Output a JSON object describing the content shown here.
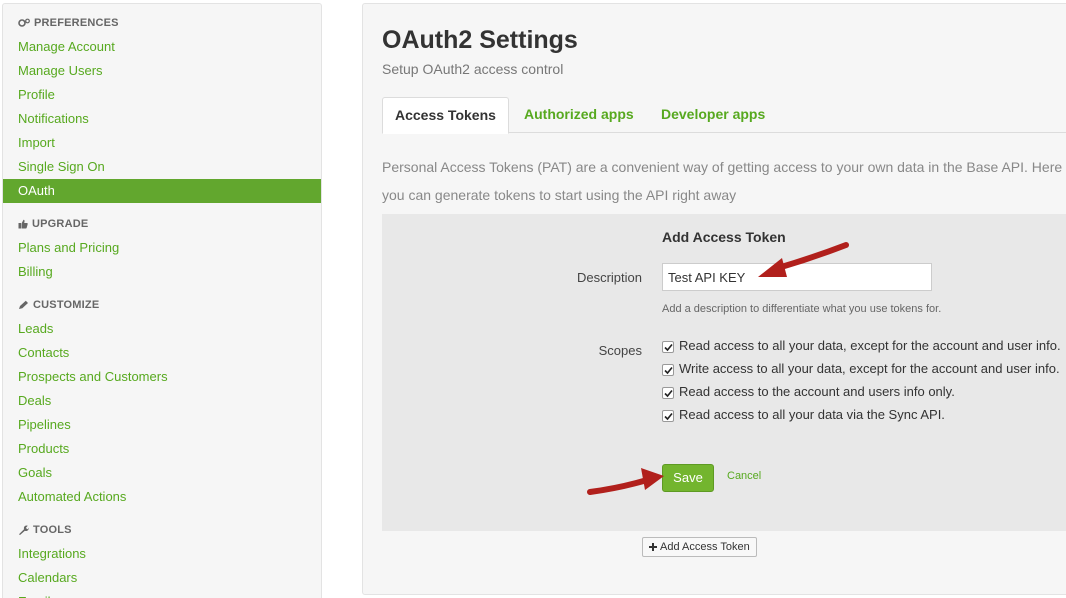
{
  "sidebar": {
    "sections": [
      {
        "title": "PREFERENCES",
        "icon": "gears-icon",
        "items": [
          "Manage Account",
          "Manage Users",
          "Profile",
          "Notifications",
          "Import",
          "Single Sign On",
          "OAuth"
        ]
      },
      {
        "title": "UPGRADE",
        "icon": "thumbs-up-icon",
        "items": [
          "Plans and Pricing",
          "Billing"
        ]
      },
      {
        "title": "CUSTOMIZE",
        "icon": "pencil-icon",
        "items": [
          "Leads",
          "Contacts",
          "Prospects and Customers",
          "Deals",
          "Pipelines",
          "Products",
          "Goals",
          "Automated Actions"
        ]
      },
      {
        "title": "TOOLS",
        "icon": "wrench-icon",
        "items": [
          "Integrations",
          "Calendars",
          "Emails"
        ]
      }
    ],
    "active_item": "OAuth"
  },
  "main": {
    "title": "OAuth2 Settings",
    "subtitle": "Setup OAuth2 access control",
    "tabs": [
      "Access Tokens",
      "Authorized apps",
      "Developer apps"
    ],
    "active_tab": "Access Tokens",
    "intro": "Personal Access Tokens (PAT) are a convenient way of getting access to your own data in the Base API. Here you can generate tokens to start using the API right away",
    "form": {
      "heading": "Add Access Token",
      "description_label": "Description",
      "description_value": "Test API KEY",
      "description_help": "Add a description to differentiate what you use tokens for.",
      "scopes_label": "Scopes",
      "scopes": [
        {
          "label": "Read access to all your data, except for the account and user info.",
          "checked": true
        },
        {
          "label": "Write access to all your data, except for the account and user info.",
          "checked": true
        },
        {
          "label": "Read access to the account and users info only.",
          "checked": true
        },
        {
          "label": "Read access to all your data via the Sync API.",
          "checked": true
        }
      ],
      "save_label": "Save",
      "cancel_label": "Cancel"
    },
    "add_token_label": "Add Access Token"
  },
  "colors": {
    "accent_green": "#57a91f",
    "active_bg": "#62a72e",
    "save_green": "#73b52e",
    "annotation_arrow": "#b1201c"
  }
}
